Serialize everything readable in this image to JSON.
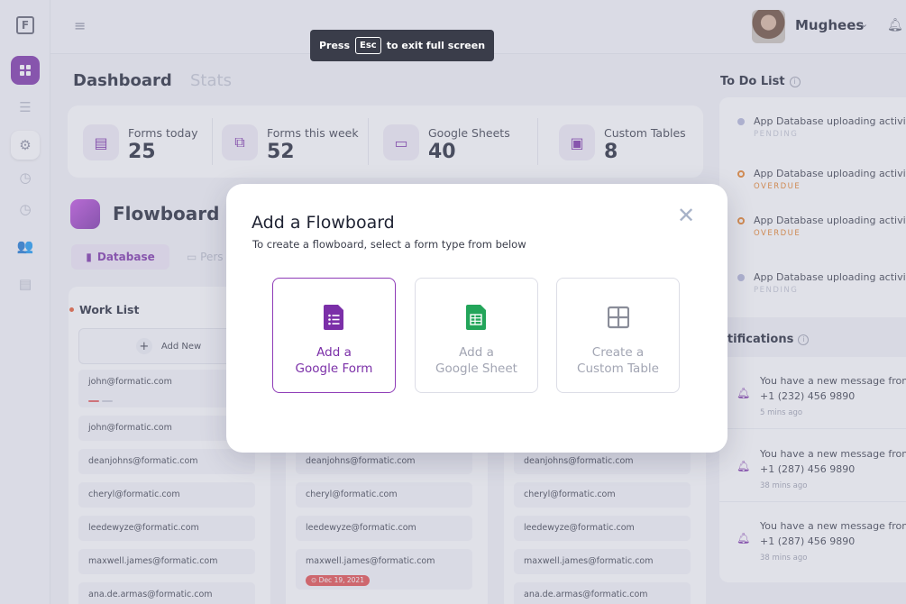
{
  "app": {
    "logo_letter": "F"
  },
  "topbar": {
    "fullscreen_press": "Press",
    "fullscreen_key": "Esc",
    "fullscreen_rest": "to exit full screen",
    "user_name": "Mughees"
  },
  "tabs": {
    "dashboard": "Dashboard",
    "stats": "Stats"
  },
  "stats": [
    {
      "label": "Forms today",
      "value": "25",
      "icon": "form-icon"
    },
    {
      "label": "Forms this week",
      "value": "52",
      "icon": "forms-stack-icon"
    },
    {
      "label": "Google Sheets",
      "value": "40",
      "icon": "sheet-icon"
    },
    {
      "label": "Custom Tables",
      "value": "8",
      "icon": "table-icon"
    }
  ],
  "flowboard": {
    "title": "Flowboard",
    "tab_database": "Database",
    "tab_personal": "Pers"
  },
  "worklist": {
    "title": "Work List",
    "add_new": "Add New",
    "col1": [
      "john@formatic.com",
      "john@formatic.com",
      "deanjohns@formatic.com",
      "cheryl@formatic.com",
      "leedewyze@formatic.com",
      "maxwell.james@formatic.com",
      "ana.de.armas@formatic.com"
    ],
    "col2": [
      "deanjohns@formatic.com",
      "cheryl@formatic.com",
      "leedewyze@formatic.com",
      "maxwell.james@formatic.com"
    ],
    "col2_badge": "Dec 19, 2021",
    "col3": [
      "deanjohns@formatic.com",
      "cheryl@formatic.com",
      "leedewyze@formatic.com",
      "maxwell.james@formatic.com",
      "ana.de.armas@formatic.com"
    ]
  },
  "todo": {
    "title": "To Do List",
    "items": [
      {
        "text": "App Database uploading activity",
        "status": "PENDING",
        "state": "pending"
      },
      {
        "text": "App Database uploading activity",
        "status": "OVERDUE",
        "state": "overdue"
      },
      {
        "text": "App Database uploading activity",
        "status": "OVERDUE",
        "state": "overdue"
      },
      {
        "text": "App Database uploading activity",
        "status": "PENDING",
        "state": "pending"
      }
    ]
  },
  "notifications": {
    "title": "otifications",
    "items": [
      {
        "line1": "You have a new message from",
        "line2": "+1 (232) 456 9890",
        "time": "5 mins ago"
      },
      {
        "line1": "You have a new message from",
        "line2": "+1 (287) 456 9890",
        "time": "38 mins ago"
      },
      {
        "line1": "You have a new message from",
        "line2": "+1 (287) 456 9890",
        "time": "38 mins ago"
      }
    ]
  },
  "modal": {
    "title": "Add a Flowboard",
    "subtitle": "To create a flowboard, select a form type from below",
    "options": [
      {
        "line1": "Add a",
        "line2": "Google Form",
        "selected": true,
        "color": "#7b2fa8"
      },
      {
        "line1": "Add a",
        "line2": "Google Sheet",
        "selected": false,
        "color": "#23a55a"
      },
      {
        "line1": "Create a",
        "line2": "Custom Table",
        "selected": false,
        "color": "#8a8d99"
      }
    ]
  },
  "colors": {
    "accent": "#7b2fa8",
    "overdue": "#e67e22",
    "danger": "#e44a4a"
  }
}
